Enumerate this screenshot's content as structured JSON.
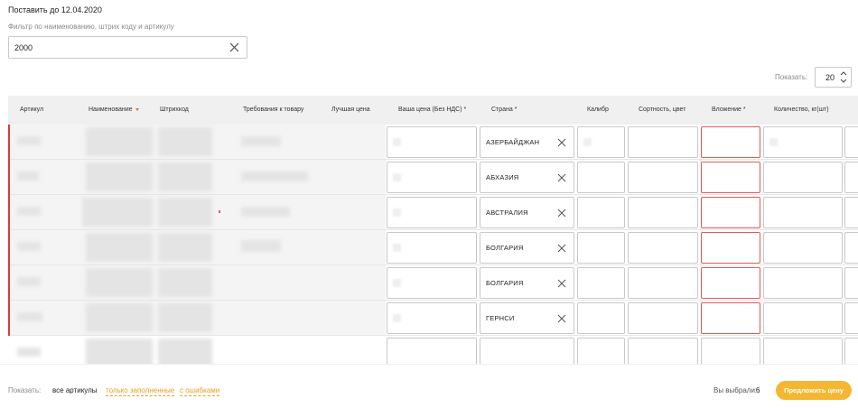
{
  "header": {
    "deadline": "Поставить до 12.04.2020",
    "filter_label": "Фильтр по наименованию, штрих коду и артикулу",
    "filter_value": "2000"
  },
  "pager": {
    "show_label": "Показать:",
    "page_size": "20"
  },
  "table": {
    "columns": [
      {
        "label": "Артикул"
      },
      {
        "label": "Наименование",
        "sorted": "desc"
      },
      {
        "label": "Штрихкод"
      },
      {
        "label": "Требования к товару"
      },
      {
        "label": "Лучшая цена"
      },
      {
        "label": "Ваша цена (Без НДС) *"
      },
      {
        "label": "Страна *"
      },
      {
        "label": "Калибр"
      },
      {
        "label": "Сортность, цвет"
      },
      {
        "label": "Вложение *"
      },
      {
        "label": "Количество, кг(шт)"
      }
    ],
    "rows": [
      {
        "country": "АЗЕРБАЙДЖАН",
        "error": true
      },
      {
        "country": "АБХАЗИЯ",
        "error": true
      },
      {
        "country": "АВСТРАЛИЯ",
        "error": true
      },
      {
        "country": "БОЛГАРИЯ",
        "error": true
      },
      {
        "country": "БОЛГАРИЯ",
        "error": true
      },
      {
        "country": "ГЕРНСИ",
        "error": true
      },
      {
        "country": "",
        "error": false
      }
    ]
  },
  "footer": {
    "show_label": "Показать:",
    "filters": [
      {
        "label": "все артикулы",
        "active": true
      },
      {
        "label": "только заполненные",
        "active": false
      },
      {
        "label": "с ошибками",
        "active": false
      }
    ],
    "selected_label": "Вы выбрали:",
    "selected_count": "6",
    "propose_button": "Предложить цену"
  },
  "colors": {
    "accent": "#f5b731",
    "link": "#e6a01a",
    "error": "#d93a3a",
    "sort_arrow": "#e0702a"
  },
  "icons": {
    "clear": "close-icon",
    "stepper": "chevron-up-down-icon",
    "sort": "sort-desc-icon"
  }
}
